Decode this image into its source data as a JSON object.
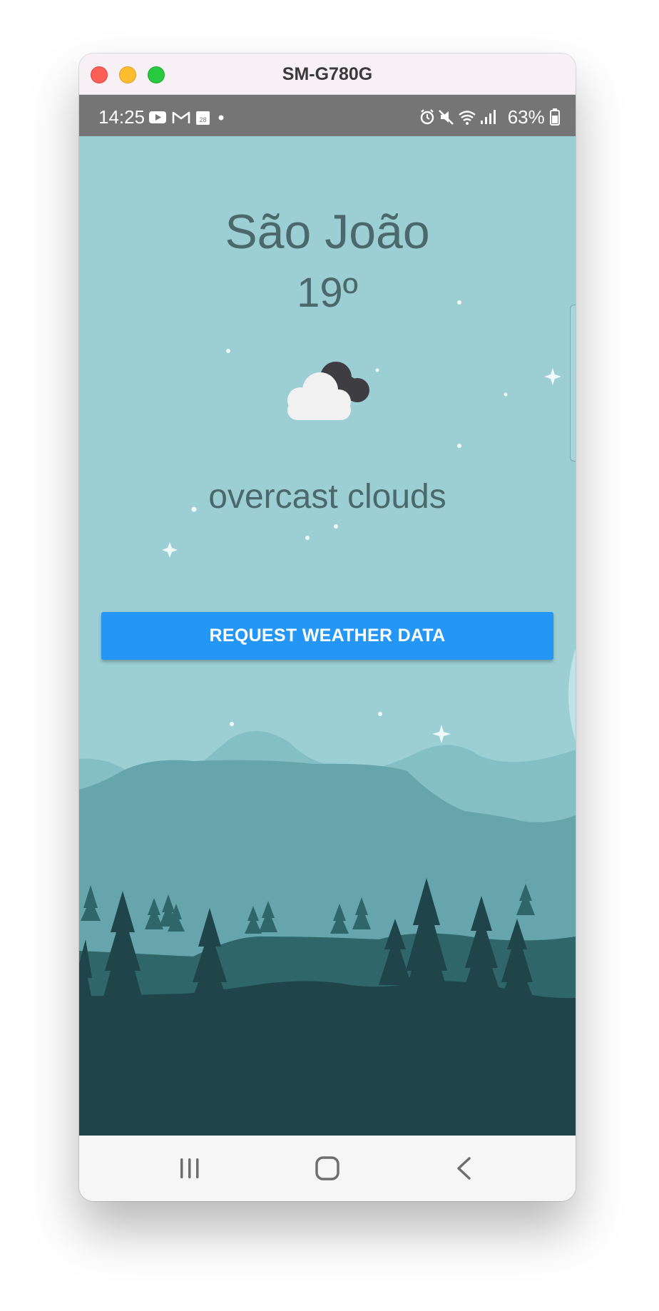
{
  "window": {
    "title": "SM-G780G"
  },
  "status_bar": {
    "time": "14:25",
    "left_icons": [
      "youtube-icon",
      "gmail-icon",
      "calendar-icon",
      "dot-icon"
    ],
    "calendar_day": "28",
    "right_icons": [
      "alarm-icon",
      "mute-icon",
      "wifi-icon",
      "signal-icon",
      "battery-icon"
    ],
    "battery_percent": "63%"
  },
  "weather": {
    "city": "São João",
    "temperature": "19º",
    "icon": "overcast-clouds-icon",
    "description": "overcast clouds"
  },
  "actions": {
    "request_label": "REQUEST WEATHER DATA"
  },
  "nav_bar": {
    "buttons": [
      "recent-apps-icon",
      "home-icon",
      "back-icon"
    ]
  },
  "colors": {
    "sky": "#9bcfd4",
    "text": "#4b686c",
    "button": "#2496f6",
    "forest_dark": "#1f444a",
    "forest_mid": "#2f666a"
  }
}
